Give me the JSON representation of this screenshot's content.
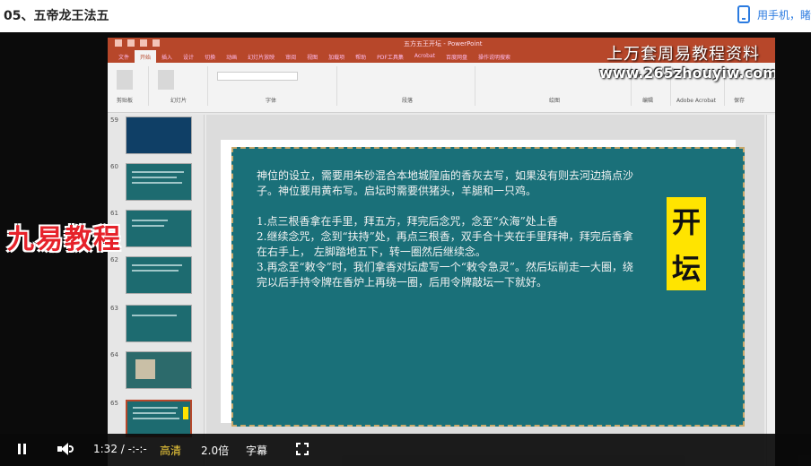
{
  "header": {
    "title": "05、五帝龙王法五",
    "phone_link": "用手机，睹"
  },
  "ppt": {
    "app_title": "五方五王开坛 - PowerPoint",
    "tabs": [
      "文件",
      "开始",
      "插入",
      "设计",
      "切换",
      "动画",
      "幻灯片放映",
      "审阅",
      "视图",
      "加载项",
      "帮助",
      "PDF工具集",
      "Acrobat",
      "百度网盘",
      "操作说明搜索"
    ],
    "ribbon_groups": [
      "剪贴板",
      "幻灯片",
      "字体",
      "段落",
      "绘图",
      "编辑",
      "Adobe Acrobat",
      "保存"
    ],
    "slide_numbers": [
      "59",
      "60",
      "61",
      "62",
      "63",
      "64",
      "65"
    ]
  },
  "watermark": {
    "line1": "上万套周易教程资料",
    "line2": "www.265zhouyiw.com"
  },
  "overlay_logo": "九易教程",
  "slide": {
    "paragraph1": "神位的设立，需要用朱砂混合本地城隍庙的香灰去写，如果没有则去河边搞点沙子。神位要用黄布写。启坛时需要供猪头，羊腿和一只鸡。",
    "paragraph2": "1.点三根香拿在手里，拜五方，拜完后念咒，念至“众海”处上香\n2.继续念咒，念到“扶持”处，再点三根香，双手合十夹在手里拜神，拜完后香拿在右手上， 左脚踏地五下，转一圈然后继续念。\n3.再念至“敕令”时，我们拿香对坛虚写一个“敕令急灵”。然后坛前走一大圈，绕完以后手持令牌在香炉上再绕一圈，后用令牌敲坛一下就好。",
    "badge_char1": "开",
    "badge_char2": "坛"
  },
  "player": {
    "time": "1:32 / -:-:-",
    "quality": "高清",
    "speed": "2.0倍",
    "subtitles": "字幕"
  }
}
